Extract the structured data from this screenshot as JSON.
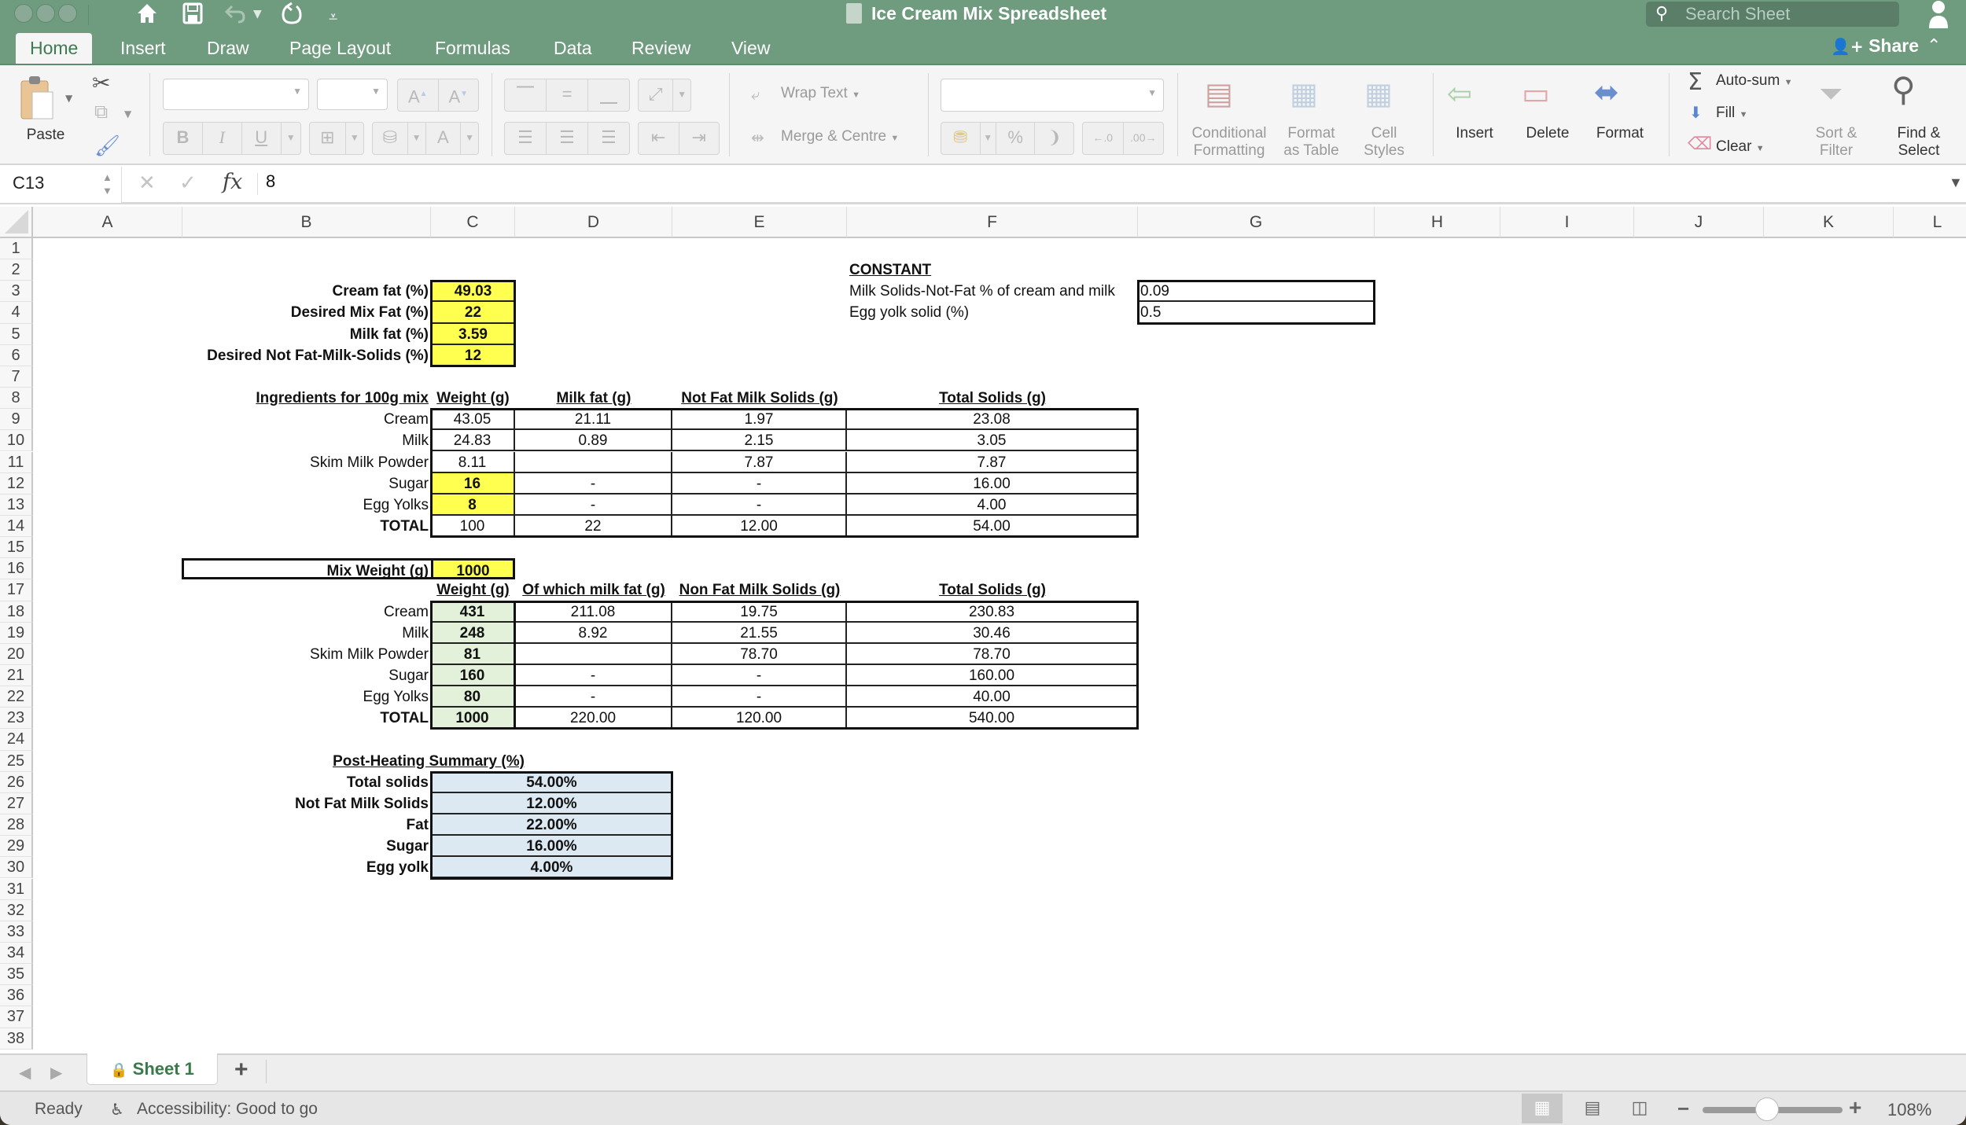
{
  "window": {
    "title": "Ice Cream Mix Spreadsheet",
    "search_placeholder": "Search Sheet"
  },
  "quick_access": {
    "home": "⌂",
    "save": "💾",
    "undo": "↶",
    "redo": "↻",
    "customize": "⩡"
  },
  "tabs": [
    {
      "label": "Home",
      "active": true
    },
    {
      "label": "Insert"
    },
    {
      "label": "Draw"
    },
    {
      "label": "Page Layout"
    },
    {
      "label": "Formulas"
    },
    {
      "label": "Data"
    },
    {
      "label": "Review"
    },
    {
      "label": "View"
    }
  ],
  "share_label": "Share",
  "ribbon": {
    "paste": "Paste",
    "wrap_text": "Wrap Text",
    "merge_centre": "Merge & Centre",
    "conditional_formatting": [
      "Conditional",
      "Formatting"
    ],
    "format_as_table": [
      "Format",
      "as Table"
    ],
    "cell_styles": [
      "Cell",
      "Styles"
    ],
    "insert": "Insert",
    "delete": "Delete",
    "format": "Format",
    "autosum": "Auto-sum",
    "fill": "Fill",
    "clear": "Clear",
    "sort_filter": [
      "Sort &",
      "Filter"
    ],
    "find_select": [
      "Find &",
      "Select"
    ],
    "bold": "B",
    "italic": "I",
    "underline": "U",
    "percent": "%"
  },
  "formula_bar": {
    "name_box": "C13",
    "formula": "8",
    "fx": "fx"
  },
  "columns": [
    "A",
    "B",
    "C",
    "D",
    "E",
    "F",
    "G",
    "H",
    "I",
    "J",
    "K",
    "L"
  ],
  "rows": [
    "1",
    "2",
    "3",
    "4",
    "5",
    "6",
    "7",
    "8",
    "9",
    "10",
    "11",
    "12",
    "13",
    "14",
    "15",
    "16",
    "17",
    "18",
    "19",
    "20",
    "21",
    "22",
    "23",
    "24",
    "25",
    "26",
    "27",
    "28",
    "29",
    "30",
    "31",
    "32",
    "33",
    "34",
    "35",
    "36",
    "37",
    "38"
  ],
  "inputs": {
    "cream_fat_label": "Cream fat (%)",
    "cream_fat": "49.03",
    "desired_mix_fat_label": "Desired Mix Fat (%)",
    "desired_mix_fat": "22",
    "milk_fat_label": "Milk fat (%)",
    "milk_fat": "3.59",
    "desired_nfms_label": "Desired Not Fat-Milk-Solids (%)",
    "desired_nfms": "12"
  },
  "constants": {
    "heading": "CONSTANT",
    "msnf_label": "Milk Solids-Not-Fat % of cream and milk",
    "msnf": "0.09",
    "egg_yolk_label": "Egg yolk solid (%)",
    "egg_yolk": "0.5"
  },
  "table100": {
    "headers": [
      "Ingredients for 100g mix",
      "Weight (g)",
      "Milk fat (g)",
      "Not Fat Milk Solids (g)",
      "Total Solids (g)"
    ],
    "rows": [
      [
        "Cream",
        "43.05",
        "21.11",
        "1.97",
        "23.08"
      ],
      [
        "Milk",
        "24.83",
        "0.89",
        "2.15",
        "3.05"
      ],
      [
        "Skim Milk Powder",
        "8.11",
        "",
        "7.87",
        "7.87"
      ],
      [
        "Sugar",
        "16",
        "-",
        "-",
        "16.00"
      ],
      [
        "Egg Yolks",
        "8",
        "-",
        "-",
        "4.00"
      ],
      [
        "TOTAL",
        "100",
        "22",
        "12.00",
        "54.00"
      ]
    ]
  },
  "mix": {
    "label": "Mix Weight (g)",
    "value": "1000",
    "headers": [
      "Weight (g)",
      "Of which milk fat (g)",
      "Non Fat Milk Solids (g)",
      "Total Solids (g)"
    ],
    "rows": [
      [
        "Cream",
        "431",
        "211.08",
        "19.75",
        "230.83"
      ],
      [
        "Milk",
        "248",
        "8.92",
        "21.55",
        "30.46"
      ],
      [
        "Skim Milk Powder",
        "81",
        "",
        "78.70",
        "78.70"
      ],
      [
        "Sugar",
        "160",
        "-",
        "-",
        "160.00"
      ],
      [
        "Egg Yolks",
        "80",
        "-",
        "-",
        "40.00"
      ],
      [
        "TOTAL",
        "1000",
        "220.00",
        "120.00",
        "540.00"
      ]
    ]
  },
  "summary": {
    "heading": "Post-Heating Summary (%)",
    "rows": [
      [
        "Total solids",
        "54.00%"
      ],
      [
        "Not Fat Milk Solids",
        "12.00%"
      ],
      [
        "Fat",
        "22.00%"
      ],
      [
        "Sugar",
        "16.00%"
      ],
      [
        "Egg yolk",
        "4.00%"
      ]
    ]
  },
  "sheet_tabs": [
    {
      "label": "Sheet 1",
      "locked": true
    }
  ],
  "status": {
    "ready": "Ready",
    "accessibility": "Accessibility: Good to go",
    "zoom": "108%",
    "zoom_fraction": 0.46
  },
  "colors": {
    "accent": "#6f9b7f",
    "input_yellow": "#ffff4f",
    "output_green": "#e3f0da",
    "summary_blue": "#dde9f2"
  }
}
